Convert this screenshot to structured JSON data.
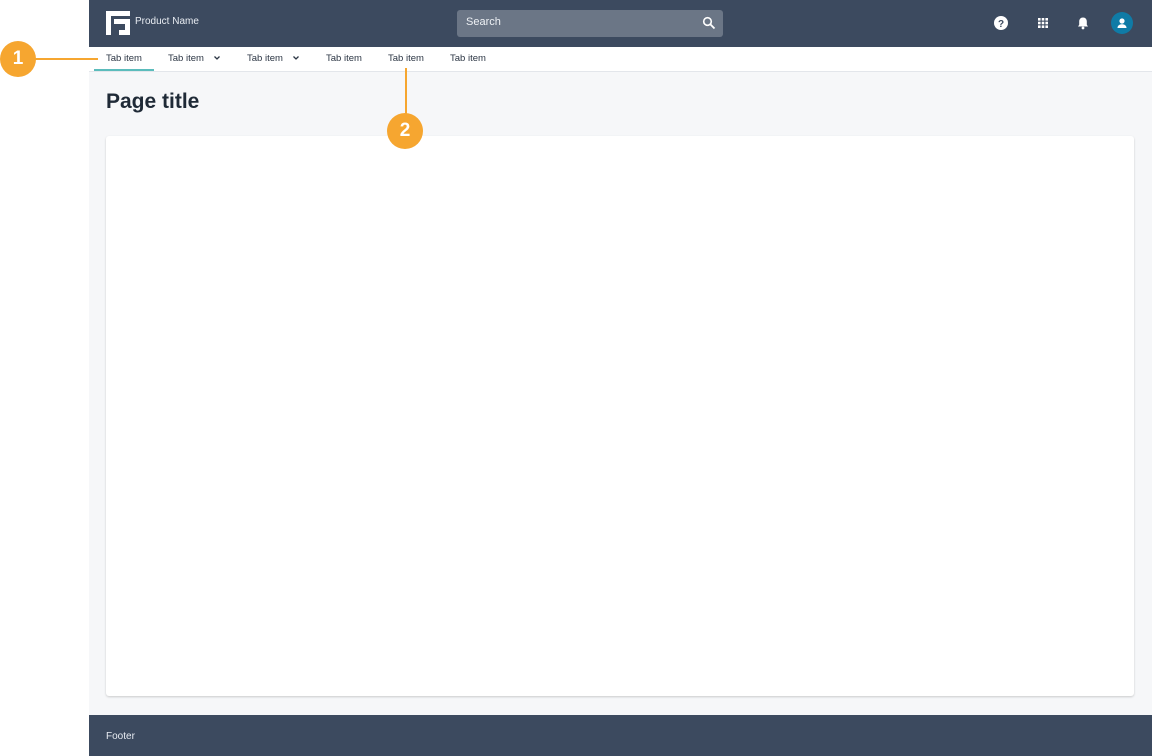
{
  "header": {
    "product_name": "Product Name",
    "search_placeholder": "Search",
    "icons": [
      "logo-icon",
      "search-icon",
      "help-icon",
      "apps-grid-icon",
      "bell-icon",
      "user-avatar-icon"
    ]
  },
  "tabs": [
    {
      "label": "Tab item",
      "active": true,
      "dropdown": false
    },
    {
      "label": "Tab item",
      "active": false,
      "dropdown": true
    },
    {
      "label": "Tab item",
      "active": false,
      "dropdown": true
    },
    {
      "label": "Tab item",
      "active": false,
      "dropdown": false
    },
    {
      "label": "Tab item",
      "active": false,
      "dropdown": false
    },
    {
      "label": "Tab item",
      "active": false,
      "dropdown": false
    }
  ],
  "page": {
    "title": "Page title"
  },
  "footer": {
    "text": "Footer"
  },
  "callouts": [
    "1",
    "2"
  ],
  "colors": {
    "header_bg": "#3c4a5f",
    "accent": "#5bbcbc",
    "callout": "#f6a630",
    "avatar": "#0f7ba6"
  }
}
